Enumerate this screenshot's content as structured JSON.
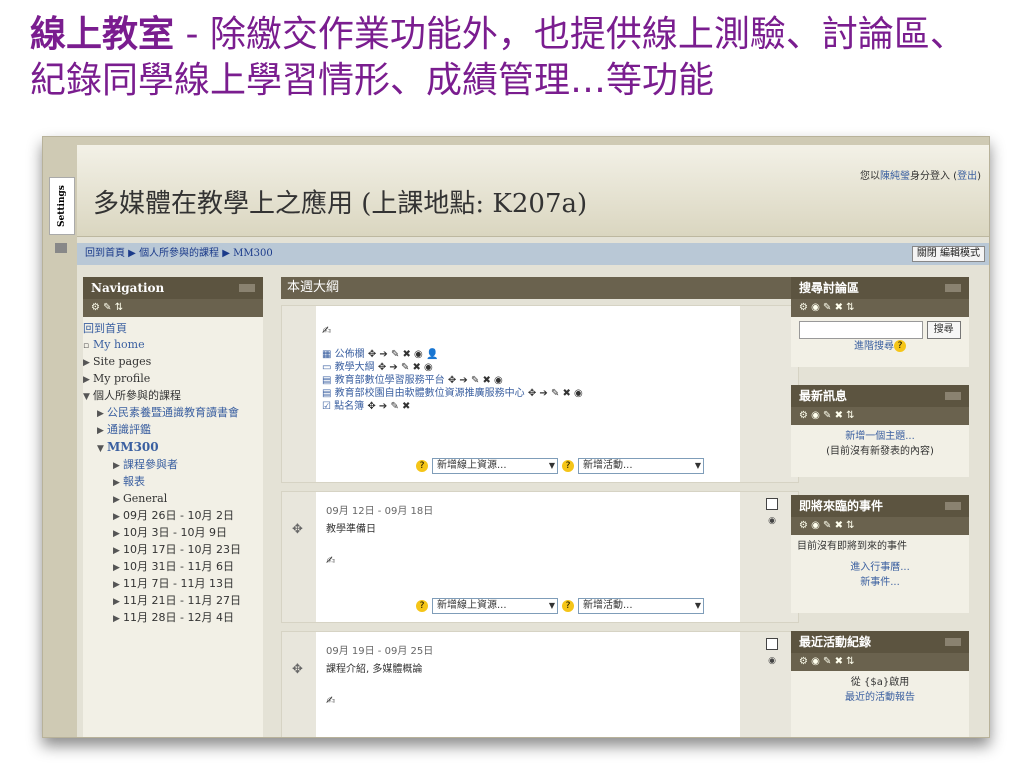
{
  "slide": {
    "title_highlight": "線上教室",
    "title_rest": " - 除繳交作業功能外，也提供線上測驗、討論區、紀錄同學線上學習情形、成績管理…等功能"
  },
  "header": {
    "course_title": "多媒體在教學上之應用 (上課地點: K207a)",
    "login_prefix": "您以",
    "login_user": "陳純瑩",
    "login_mid": "身分登入 (",
    "logout": "登出",
    "login_suffix": ")"
  },
  "settings_tab": "Settings",
  "breadcrumb": {
    "home": "回到首頁",
    "sep1": " ▶ ",
    "courses": "個人所參與的課程",
    "sep2": " ▶ ",
    "current": "MM300",
    "edit_button": "關閉 編輯模式"
  },
  "navigation": {
    "title": "Navigation",
    "controls": "⚙ ✎ ⇅",
    "home": "回到首頁",
    "items": [
      "My home",
      "Site pages",
      "My profile"
    ],
    "my_courses": "個人所參與的課程",
    "course1": "公民素養暨通識教育讀書會",
    "course2": "通識評鑑",
    "current_course": "MM300",
    "sub": [
      "課程參與者",
      "報表",
      "General",
      "09月 26日 - 10月 2日",
      "10月 3日 - 10月 9日",
      "10月 17日 - 10月 23日",
      "10月 31日 - 11月 6日",
      "11月 7日 - 11月 13日",
      "11月 21日 - 11月 27日",
      "11月 28日 - 12月 4日"
    ]
  },
  "main": {
    "outline_title": "本週大綱",
    "resources": [
      {
        "name": "公佈欄",
        "icons": "✥ ➔ ✎ ✖ ◉ 👤"
      },
      {
        "name": "教學大綱",
        "icons": "✥ ➔ ✎ ✖ ◉"
      },
      {
        "name": "教育部數位學習服務平台",
        "icons": "✥ ➔ ✎ ✖ ◉"
      },
      {
        "name": "教育部校園自由軟體數位資源推廣服務中心",
        "icons": "✥ ➔ ✎ ✖ ◉"
      },
      {
        "name": "點名簿",
        "icons": "✥ ➔ ✎ ✖"
      }
    ],
    "add_resource": "新增線上資源...",
    "add_activity": "新增活動...",
    "week1": {
      "date": "09月 12日 - 09月 18日",
      "desc": "教學準備日"
    },
    "week2": {
      "date": "09月 19日 - 09月 25日",
      "desc": "課程介紹, 多媒體概論"
    }
  },
  "blocks": {
    "search": {
      "title": "搜尋討論區",
      "button": "搜尋",
      "advanced": "進階搜尋"
    },
    "news": {
      "title": "最新訊息",
      "add": "新增一個主題...",
      "none": "(目前沒有新發表的內容)"
    },
    "events": {
      "title": "即將來臨的事件",
      "none": "目前沒有即將到來的事件",
      "calendar": "進入行事曆...",
      "new_event": "新事件..."
    },
    "recent": {
      "title": "最近活動紀錄",
      "from": "從 {$a}啟用",
      "report": "最近的活動報告"
    },
    "controls": "⚙ ◉ ✎ ✖ ⇅"
  }
}
